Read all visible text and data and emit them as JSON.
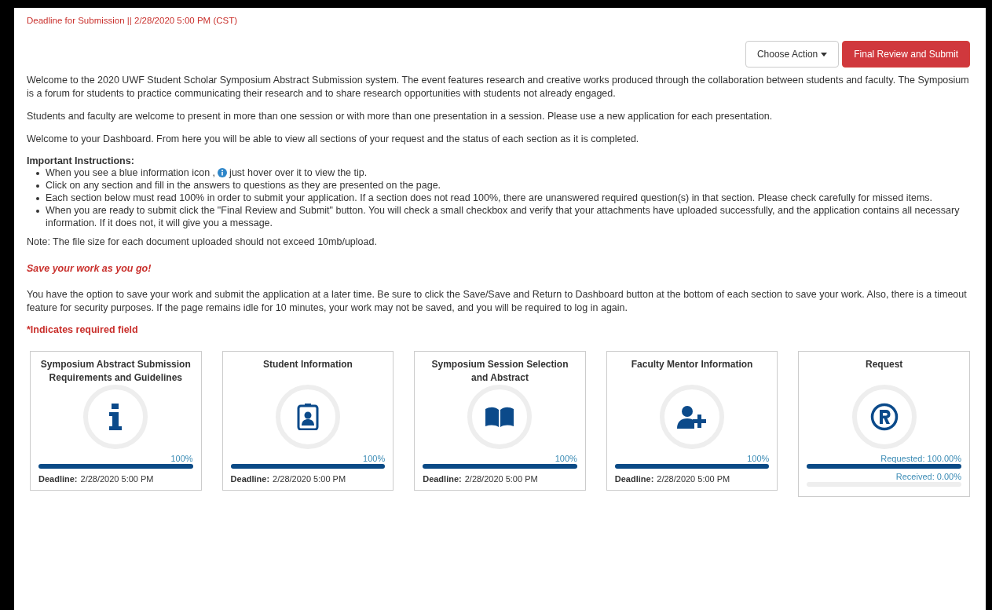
{
  "deadline_banner": "Deadline for Submission || 2/28/2020 5:00 PM (CST)",
  "actions": {
    "choose_action": "Choose Action",
    "submit": "Final Review and Submit"
  },
  "intro_paragraphs": [
    "Welcome to the 2020 UWF Student Scholar Symposium Abstract Submission system.  The event features research and creative works produced through the collaboration between students and faculty.  The Symposium is a forum for students to practice communicating their research and to share research opportunities with students not already engaged.",
    "Students and faculty are welcome to present in more than one session or with more than one presentation in a session. Please use a new application for each presentation.",
    "Welcome to your Dashboard. From here you will be able to view all sections of your request and the status of each section as it is completed."
  ],
  "instructions": {
    "heading": "Important Instructions:",
    "items": [
      {
        "before_icon": "When you see a blue information icon ,",
        "after_icon": "just hover over it to view the tip."
      },
      {
        "text": "Click on any section and fill in the answers to questions as they are presented on the page."
      },
      {
        "text": "Each section below must read 100% in order to submit your application. If a section does not read 100%, there are unanswered required question(s) in that section. Please check carefully for missed items."
      },
      {
        "text": "When you are ready to submit click the \"Final Review and Submit\" button. You will check a small checkbox and verify that your attachments have uploaded successfully, and the application contains all necessary information. If it does not, it will give you a message."
      }
    ]
  },
  "note": "Note: The file size for each document uploaded should not exceed 10mb/upload.",
  "save_heading": "Save your work as you go!",
  "save_paragraph": "You have the option to save your work and submit the application at a later time. Be sure to click the Save/Save and Return to Dashboard button at the bottom of each section to save your work. Also, there is a timeout feature for security purposes. If the page remains idle for 10 minutes, your work may not be saved, and you will be required to log in again.",
  "required_note": "*Indicates required field",
  "sections": [
    {
      "title": "Symposium Abstract Submission Requirements and Guidelines",
      "kind": "info",
      "bars": [
        {
          "label": "100%",
          "level": 1
        }
      ],
      "deadline_label": "Deadline:",
      "deadline": "2/28/2020 5:00 PM"
    },
    {
      "title": "Student Information",
      "kind": "badge",
      "bars": [
        {
          "label": "100%",
          "level": 1
        }
      ],
      "deadline_label": "Deadline:",
      "deadline": "2/28/2020 5:00 PM"
    },
    {
      "title": "Symposium Session Selection and Abstract",
      "kind": "book",
      "bars": [
        {
          "label": "100%",
          "level": 1
        }
      ],
      "deadline_label": "Deadline:",
      "deadline": "2/28/2020 5:00 PM"
    },
    {
      "title": "Faculty Mentor Information",
      "kind": "user-plus",
      "bars": [
        {
          "label": "100%",
          "level": 1
        }
      ],
      "deadline_label": "Deadline:",
      "deadline": "2/28/2020 5:00 PM"
    },
    {
      "title": "Request",
      "kind": "registered",
      "bars": [
        {
          "label": "Requested: 100.00%",
          "level": 1
        },
        {
          "label": "Received: 0.00%",
          "level": 0
        }
      ]
    }
  ]
}
